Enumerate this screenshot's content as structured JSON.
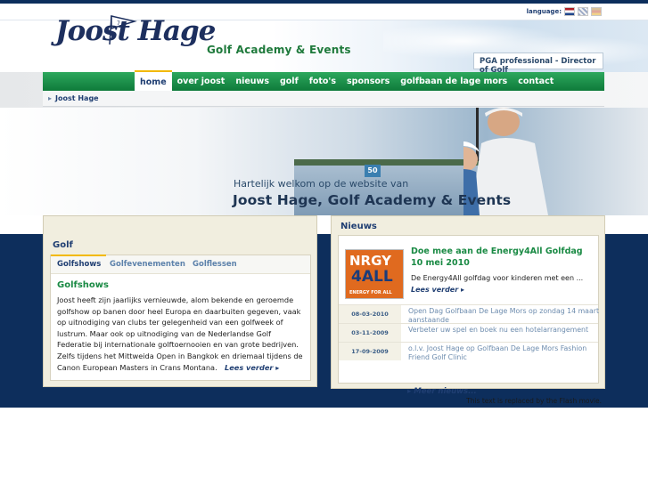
{
  "language": {
    "label": "language:",
    "flags": [
      "nl-flag-icon",
      "en-flag-icon",
      "de-flag-icon"
    ]
  },
  "header": {
    "logo": "Joost Hage",
    "tagline": "Golf Academy & Events",
    "pga": "PGA professional - Director of Golf"
  },
  "nav": {
    "items": [
      {
        "label": "home",
        "active": true
      },
      {
        "label": "over joost"
      },
      {
        "label": "nieuws"
      },
      {
        "label": "golf"
      },
      {
        "label": "foto's"
      },
      {
        "label": "sponsors"
      },
      {
        "label": "golfbaan de lage mors"
      },
      {
        "label": "contact"
      }
    ]
  },
  "breadcrumb": {
    "current": "Joost Hage"
  },
  "hero": {
    "welcome": "Hartelijk welkom op de website van",
    "title": "Joost Hage, Golf Academy & Events",
    "sign_number": "50"
  },
  "golf": {
    "title": "Golf",
    "tabs": [
      "Golfshows",
      "Golfevenementen",
      "Golflessen"
    ],
    "heading": "Golfshows",
    "body": "Joost heeft zijn jaarlijks vernieuwde, alom bekende en geroemde golfshow op banen door heel Europa en daarbuiten gegeven, vaak op uitnodiging van clubs ter gelegenheid van een golfweek of lustrum. Maar ook op uitnodiging van de Nederlandse Golf Federatie bij internationale golftoernooien en van grote bedrijven. Zelfs tijdens het Mittweida Open in Bangkok en driemaal tijdens de Canon European Masters in Crans Montana.",
    "more": "Lees verder"
  },
  "news": {
    "title": "Nieuws",
    "logo": {
      "line1": "NRGY",
      "line2": "4ALL",
      "line3": "ENERGY FOR ALL"
    },
    "featured_title": "Doe mee aan de Energy4All Golfdag 10 mei 2010",
    "featured_text": "De Energy4All golfdag  voor kinderen met een ...",
    "more": "Lees verder",
    "items": [
      {
        "date": "08-03-2010",
        "text": "Open Dag Golfbaan De Lage Mors op zondag 14 maart aanstaande"
      },
      {
        "date": "03-11-2009",
        "text": "Verbeter uw spel en boek nu een hotelarrangement"
      },
      {
        "date": "17-09-2009",
        "text": "o.l.v. Joost Hage op Golfbaan De Lage Mors Fashion Friend Golf Clinic"
      }
    ],
    "all": "Meer nieuws..."
  },
  "flash_note": "This text is replaced by the Flash movie."
}
